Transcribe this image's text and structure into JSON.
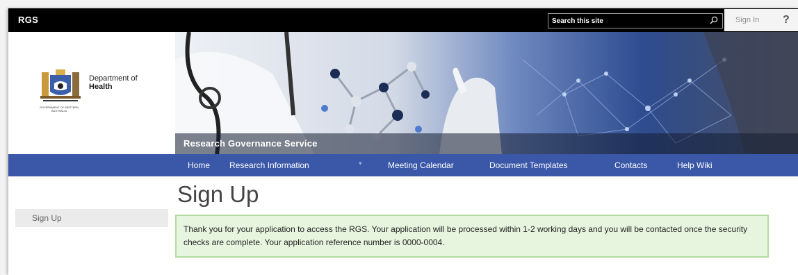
{
  "topbar": {
    "site_name": "RGS",
    "search_placeholder": "Search this site",
    "search_icon": "magnifier-icon",
    "sign_in": "Sign In",
    "help": "?"
  },
  "logo": {
    "dept_line1": "Department of",
    "dept_line2": "Health",
    "crest_caption": "GOVERNMENT OF WESTERN AUSTRALIA"
  },
  "banner": {
    "title": "Research Governance Service"
  },
  "nav": {
    "items": [
      "Home",
      "Research Information",
      "Meeting Calendar",
      "Document Templates",
      "Contacts",
      "Help Wiki"
    ],
    "dropdown_icon": "chevron-down-icon"
  },
  "sidebar": {
    "items": [
      "Sign Up"
    ]
  },
  "page": {
    "title": "Sign Up",
    "message": "Thank you for your application to access the RGS. Your application will be processed within 1-2 working days and you will be contacted once the security checks are complete. Your application reference number is 0000-0004."
  },
  "colors": {
    "topbar": "#000000",
    "nav": "#3a57a8",
    "message_bg": "#e7f5df",
    "message_border": "#b2dc9f"
  }
}
